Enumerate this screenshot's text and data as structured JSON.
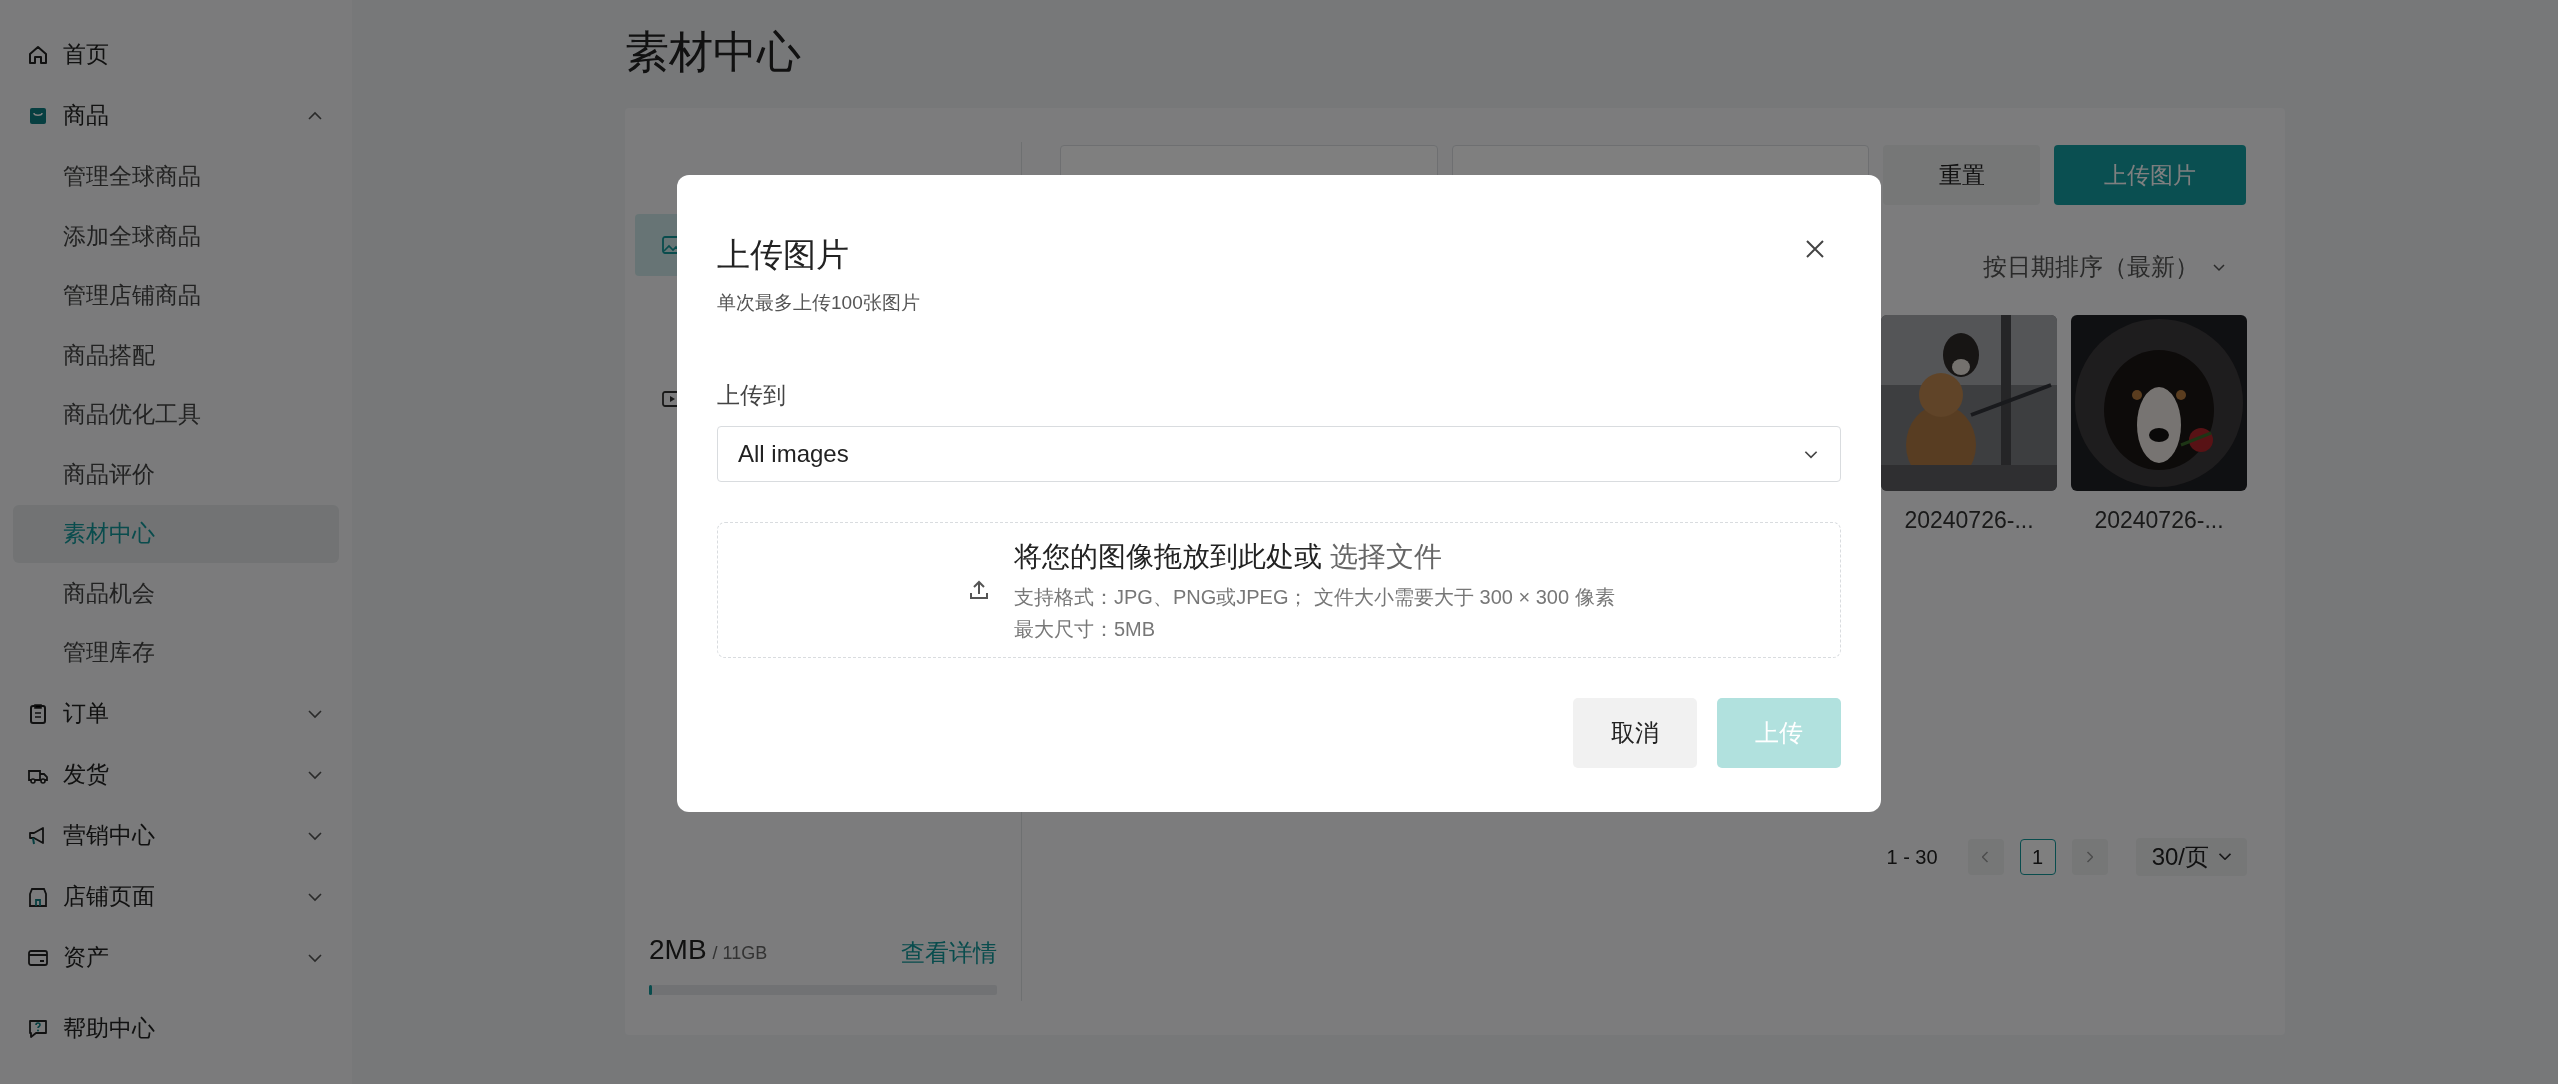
{
  "page_title": "素材中心",
  "sidebar": {
    "items": [
      {
        "kind": "link",
        "label": "首页"
      },
      {
        "kind": "group",
        "label": "商品",
        "expanded": true,
        "children": [
          {
            "label": "管理全球商品",
            "selected": false
          },
          {
            "label": "添加全球商品",
            "selected": false
          },
          {
            "label": "管理店铺商品",
            "selected": false
          },
          {
            "label": "商品搭配",
            "selected": false
          },
          {
            "label": "商品优化工具",
            "selected": false
          },
          {
            "label": "商品评价",
            "selected": false
          },
          {
            "label": "素材中心",
            "selected": true
          },
          {
            "label": "商品机会",
            "selected": false
          },
          {
            "label": "管理库存",
            "selected": false
          }
        ]
      },
      {
        "kind": "group",
        "label": "订单",
        "expanded": false
      },
      {
        "kind": "group",
        "label": "发货",
        "expanded": false
      },
      {
        "kind": "group",
        "label": "营销中心",
        "expanded": false
      },
      {
        "kind": "group",
        "label": "店铺页面",
        "expanded": false
      },
      {
        "kind": "group",
        "label": "资产",
        "expanded": false
      },
      {
        "kind": "link",
        "label": "帮助中心"
      }
    ]
  },
  "folders": {
    "items": [
      {
        "kind": "images",
        "selected": true
      },
      {
        "kind": "videos",
        "selected": false
      }
    ]
  },
  "storage": {
    "used": "2MB",
    "total": "/ 11GB",
    "details_link": "查看详情",
    "level": 0.01
  },
  "toolbar": {
    "reset_button": "重置",
    "upload_button": "上传图片"
  },
  "sort": "按日期排序（最新）",
  "images": [
    {
      "caption": "20240726-..."
    },
    {
      "caption": "20240726-..."
    }
  ],
  "pagination": {
    "range": "1 - 30",
    "pages": [
      {
        "label": "1",
        "selected": true
      }
    ],
    "page_size": "30/页"
  },
  "dialog": {
    "title": "上传图片",
    "subtitle": "单次最多上传100张图片",
    "target_label": "上传到",
    "target_value": "All images",
    "dropzone": {
      "main_text": "将您的图像拖放到此处或",
      "choose_link": "选择文件",
      "formats": "支持格式：JPG、PNG或JPEG； 文件大小需要大于 300 × 300 像素",
      "max_size": "最大尺寸：5MB"
    },
    "cancel_button": "取消",
    "upload_button": {
      "label": "上传",
      "disabled": true
    }
  }
}
